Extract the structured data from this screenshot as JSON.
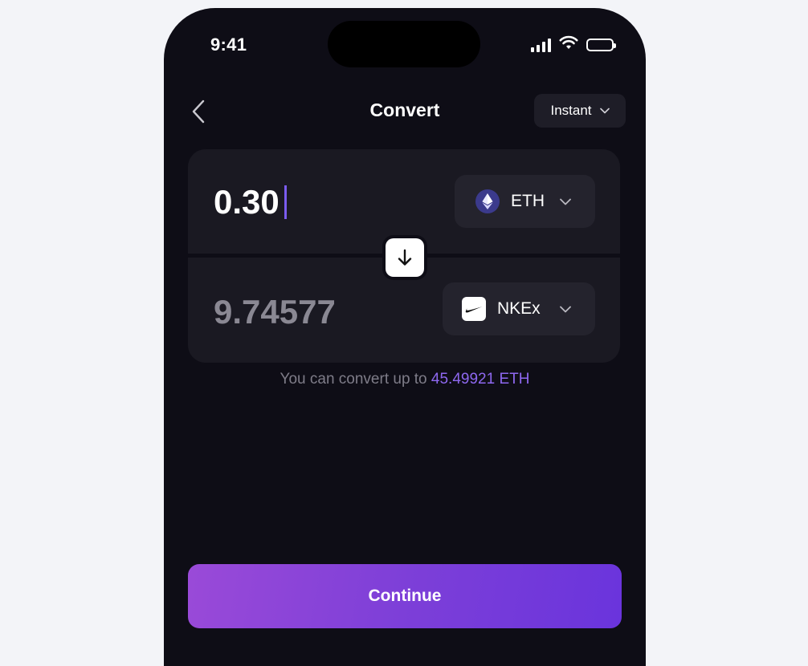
{
  "status_bar": {
    "time": "9:41",
    "icons": [
      "signal-icon",
      "wifi-icon",
      "battery-icon"
    ]
  },
  "header": {
    "back_icon": "chevron-left-icon",
    "title": "Convert",
    "mode": {
      "selected": "Instant",
      "icon": "chevron-down-icon"
    }
  },
  "from": {
    "amount": "0.30",
    "token": {
      "symbol": "ETH",
      "icon": "ethereum-icon"
    }
  },
  "swap": {
    "icon": "arrow-down-icon"
  },
  "to": {
    "amount": "9.74577",
    "token": {
      "symbol": "NKEx",
      "icon": "nike-swoosh-icon"
    }
  },
  "limit": {
    "prefix": "You can convert up to",
    "amount": "45.49921 ETH"
  },
  "continue_label": "Continue",
  "colors": {
    "background": "#0e0d16",
    "card": "#1a1922",
    "accent": "#8e68f0",
    "button_gradient_start": "#9a4ad8",
    "button_gradient_end": "#6a34dc"
  }
}
